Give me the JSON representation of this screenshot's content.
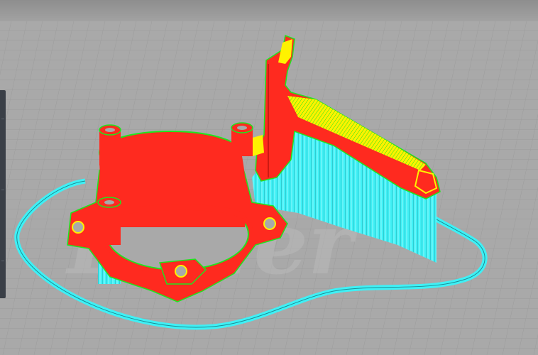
{
  "viewer": {
    "watermark_text": "Ender",
    "colors": {
      "background": "#a9a9a9",
      "grid_line": "#9a9a9a",
      "wall_outer": "#ff2a1f",
      "wall_inner": "#1ee61e",
      "infill": "#fff200",
      "support": "#3ff0f5",
      "skirt": "#3ff0f5",
      "side_panel": "#3a3f47"
    }
  },
  "left_panel": {
    "icons": [
      "panel-handle-icon"
    ]
  }
}
